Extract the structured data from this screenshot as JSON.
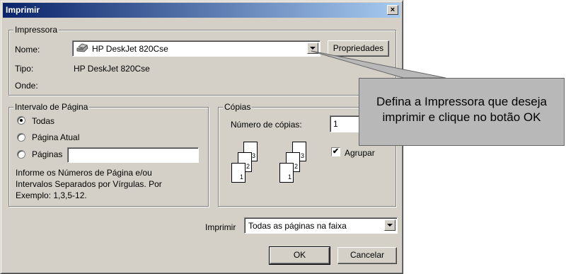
{
  "window": {
    "title": "Imprimir",
    "close_glyph": "×"
  },
  "printer": {
    "legend": "Impressora",
    "name_label": "Nome:",
    "name_value": "HP DeskJet 820Cse",
    "properties_button": "Propriedades",
    "type_label": "Tipo:",
    "type_value": "HP DeskJet 820Cse",
    "where_label": "Onde:"
  },
  "page_range": {
    "legend": "Intervalo de Página",
    "options": [
      {
        "label": "Todas",
        "selected": true
      },
      {
        "label": "Página Atual",
        "selected": false
      },
      {
        "label": "Páginas",
        "selected": false
      }
    ],
    "pages_value": "",
    "hint_lines": [
      "Informe os Números de Página e/ou",
      "Intervalos Separados por Vírgulas. Por",
      "Exemplo: 1,3,5-12."
    ]
  },
  "copies": {
    "legend": "Cópias",
    "count_label": "Número de cópias:",
    "count_value": "1",
    "collate_label": "Agrupar",
    "collate_checked": true,
    "page_numbers": [
      "1",
      "2",
      "3"
    ]
  },
  "print_what": {
    "label": "Imprimir",
    "value": "Todas as páginas na faixa"
  },
  "buttons": {
    "ok": "OK",
    "cancel": "Cancelar"
  },
  "callout": {
    "lines": [
      "Defina a Impressora que deseja",
      "imprimir e clique no botão OK"
    ]
  },
  "icons": {
    "printer": "printer-icon",
    "dropdown": "chevron-down-icon",
    "check": "✔"
  }
}
